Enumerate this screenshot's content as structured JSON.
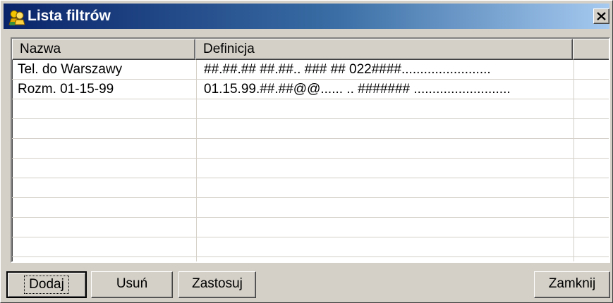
{
  "window": {
    "title": "Lista filtrów",
    "icon": "filter-people-icon",
    "close_glyph": "close-icon"
  },
  "table": {
    "columns": [
      {
        "label": "Nazwa"
      },
      {
        "label": "Definicja"
      },
      {
        "label": ""
      }
    ],
    "rows": [
      {
        "name": "Tel. do Warszawy",
        "definition": "##.##.## ##.##..  ### ## 022####........................"
      },
      {
        "name": "Rozm. 01-15-99",
        "definition": "01.15.99.##.##@@...... .. ####### .........................."
      }
    ],
    "empty_rows": 8
  },
  "buttons": {
    "add": "Dodaj",
    "remove": "Usuń",
    "apply": "Zastosuj",
    "close": "Zamknij"
  },
  "colors": {
    "title_start": "#0a246a",
    "title_end": "#a6caf0",
    "face": "#d4d0c8"
  }
}
